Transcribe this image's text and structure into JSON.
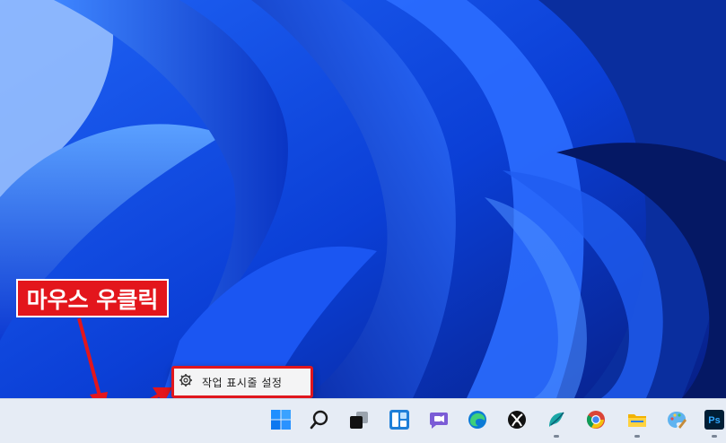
{
  "desktop": {
    "wallpaper": "windows-11-bloom-blue",
    "accent": "#1a5cff"
  },
  "annotation": {
    "callout_text": "마우스 우클릭",
    "callout_color": "#e3161c"
  },
  "context_menu": {
    "item_label": "작업 표시줄 설정",
    "item_icon": "gear-icon"
  },
  "taskbar": {
    "icons": [
      {
        "name": "start-icon",
        "running": false
      },
      {
        "name": "search-icon",
        "running": false
      },
      {
        "name": "task-view-icon",
        "running": false
      },
      {
        "name": "widgets-icon",
        "running": false
      },
      {
        "name": "teams-chat-icon",
        "running": false
      },
      {
        "name": "edge-icon",
        "running": false
      },
      {
        "name": "xbox-icon",
        "running": false
      },
      {
        "name": "app-icon",
        "running": true
      },
      {
        "name": "chrome-icon",
        "running": false
      },
      {
        "name": "file-explorer-icon",
        "running": true
      },
      {
        "name": "paint-icon",
        "running": false
      },
      {
        "name": "photoshop-icon",
        "running": true
      }
    ],
    "photoshop_label": "Ps"
  }
}
